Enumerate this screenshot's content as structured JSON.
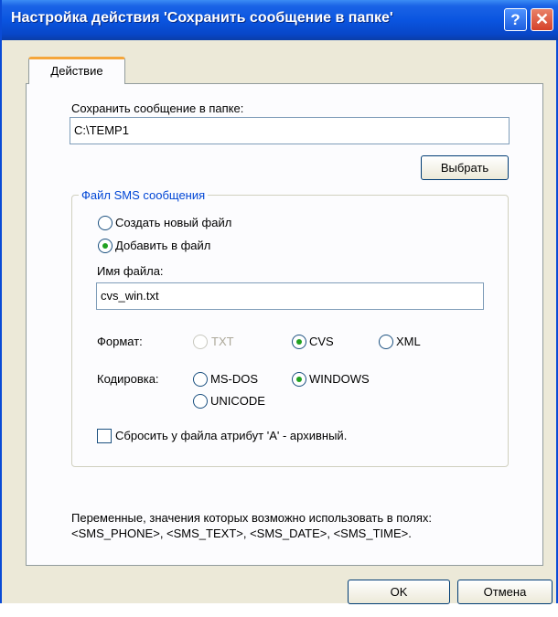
{
  "window": {
    "title": "Настройка действия 'Сохранить сообщение в папке'",
    "help_label": "?",
    "close_label": "✕"
  },
  "tab": {
    "label": "Действие"
  },
  "folder": {
    "label": "Сохранить сообщение в папке:",
    "value": "C:\\TEMP1",
    "browse_label": "Выбрать"
  },
  "sms_group": {
    "title": "Файл SMS сообщения",
    "create_new_label": "Создать новый файл",
    "append_label": "Добавить в файл",
    "selected_mode": "append",
    "filename_label": "Имя файла:",
    "filename_value": "cvs_win.txt",
    "format": {
      "label": "Формат:",
      "options": [
        "TXT",
        "CVS",
        "XML"
      ],
      "selected": "CVS",
      "disabled": [
        "TXT"
      ]
    },
    "encoding": {
      "label": "Кодировка:",
      "options": [
        "MS-DOS",
        "WINDOWS",
        "UNICODE"
      ],
      "selected": "WINDOWS"
    },
    "reset_archive_label": "Сбросить у файла атрибут 'A' - архивный.",
    "reset_archive_checked": false
  },
  "variables": {
    "line1": "Переменные, значения которых возможно использовать в полях:",
    "line2": "<SMS_PHONE>, <SMS_TEXT>, <SMS_DATE>, <SMS_TIME>."
  },
  "buttons": {
    "ok": "OK",
    "cancel": "Отмена"
  },
  "colors": {
    "titlebar": "#0a55e0",
    "dialog_bg": "#ece9d8",
    "group_title": "#0046d5",
    "radio_dot": "#21a121",
    "tab_accent": "#f5a63b"
  }
}
